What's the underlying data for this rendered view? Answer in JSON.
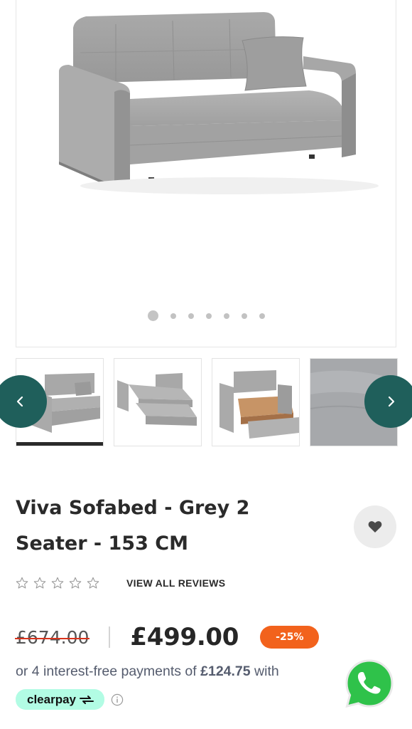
{
  "product": {
    "title_line1": "Viva Sofabed - Grey 2",
    "title_line2": "Seater - 153 CM",
    "reviews_link": "VIEW ALL REVIEWS",
    "rating_stars": 0,
    "price_old": "£674.00",
    "price_new": "£499.00",
    "discount": "-25%",
    "installments_prefix": "or 4 interest-free payments of",
    "installments_amount": "£124.75",
    "installments_suffix": "with",
    "clearpay_label": "clearpay"
  },
  "gallery": {
    "total_images": 7,
    "active_index": 0,
    "thumbnails": [
      "sofa-front-thumb",
      "sofabed-open-thumb",
      "storage-open-thumb",
      "fabric-closeup-thumb"
    ]
  },
  "colors": {
    "nav_button": "#1f5f5b",
    "discount_badge": "#f2621c",
    "clearpay_badge": "#b2fce4",
    "whatsapp_green": "#2fc24a",
    "strikethrough": "#d8321c"
  },
  "icons": {
    "prev": "chevron-left-icon",
    "next": "chevron-right-icon",
    "wishlist": "heart-icon",
    "info": "info-icon",
    "whatsapp": "whatsapp-icon",
    "star": "star-outline-icon"
  }
}
